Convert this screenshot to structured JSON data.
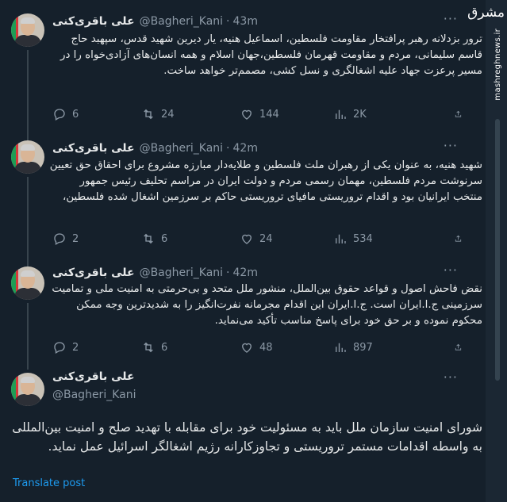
{
  "watermark": {
    "logo": "مشرق",
    "url": "mashreghnews.ir"
  },
  "tweets": [
    {
      "name": "علی باقری‌کنی",
      "handle": "@Bagheri_Kani",
      "dot": "·",
      "time": "43m",
      "text": "ترور بزدلانه رهبر پرافتخار مقاومت فلسطین، اسماعیل هنیه، یار دیرین شهید قدس، سپهبد حاج قاسم سلیمانی، مردم و مقاومت قهرمان فلسطین،جهان اسلام و همه انسان‌های آزادی‌خواه را در مسیر پرعزت جهاد علیه اشغالگری و نسل کشی، مصمم‌تر خواهد ساخت.",
      "replies": "6",
      "retweets": "24",
      "likes": "144",
      "views": "2K"
    },
    {
      "name": "علی باقری‌کنی",
      "handle": "@Bagheri_Kani",
      "dot": "·",
      "time": "42m",
      "text": "شهید هنیه، به عنوان یکی از رهبران ملت فلسطین و طلایه‌دار مبارزه مشروع برای احقاق حق تعیین سرنوشت مردم فلسطین، مهمان رسمی مردم و دولت ایران در مراسم تحلیف رئیس جمهور منتخب ایرانیان بود و اقدام تروریستی مافیای تروریستی حاکم بر سرزمین اشغال شده فلسطین،",
      "replies": "2",
      "retweets": "6",
      "likes": "24",
      "views": "534"
    },
    {
      "name": "علی باقری‌کنی",
      "handle": "@Bagheri_Kani",
      "dot": "·",
      "time": "42m",
      "text": "نقض فاحش اصول و قواعد حقوق بین‌الملل، منشور ملل متحد و بی‌حرمتی به امنیت ملی و تمامیت سرزمینی ج.ا.ایران است. ج.ا.ایران این اقدام مجرمانه نفرت‌انگیز را به شدیدترین وجه ممکن محکوم نموده و بر حق خود برای پاسخ مناسب تأکید می‌نماید.",
      "replies": "2",
      "retweets": "6",
      "likes": "48",
      "views": "897"
    }
  ],
  "main_tweet": {
    "name": "علی باقری‌کنی",
    "handle": "@Bagheri_Kani",
    "text": "شورای امنیت سازمان ملل باید به مسئولیت خود برای مقابله با تهدید صلح و امنیت بین‌المللی به واسطه اقدامات مستمر تروریستی و تجاوزکارانه رژیم اشغالگر اسرائیل عمل نماید.",
    "translate_label": "Translate post"
  },
  "more_label": "···",
  "colors": {
    "background": "#15202b",
    "muted": "#8b98a5",
    "accent": "#1d9bf0",
    "border": "#38444d"
  },
  "icons": [
    "reply-icon",
    "retweet-icon",
    "like-icon",
    "views-icon",
    "share-icon",
    "more-icon"
  ]
}
